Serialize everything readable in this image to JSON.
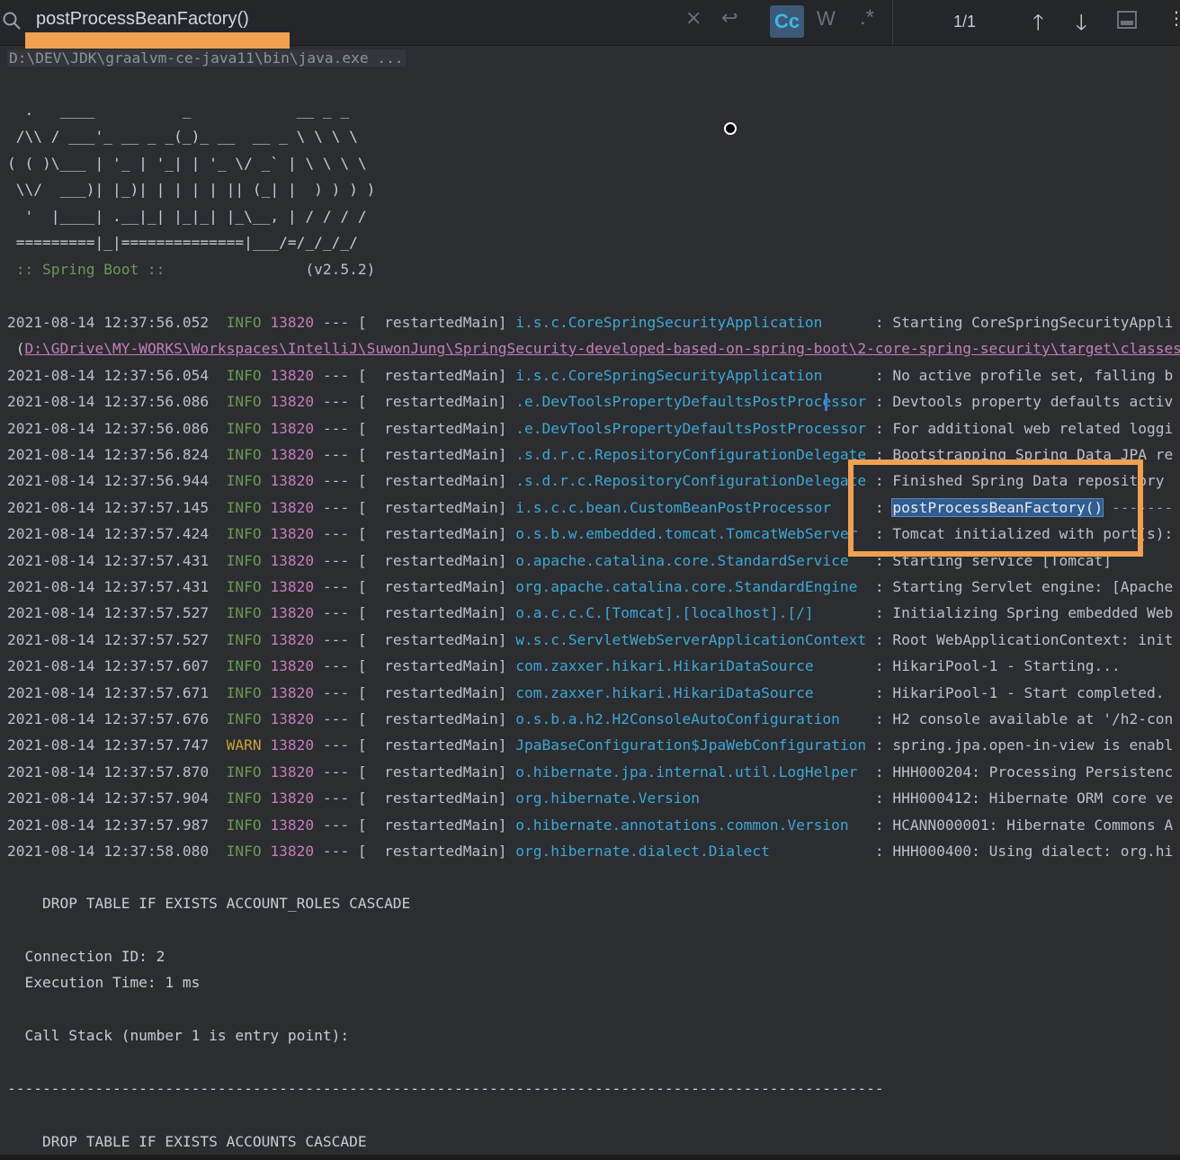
{
  "search": {
    "query": "postProcessBeanFactory()",
    "clear_glyph": "×",
    "newline_glyph": "↩",
    "match_case_label": "Cc",
    "words_label": "W",
    "regex_label": ".*",
    "match_count": "1/1",
    "prev_glyph": "🡑",
    "next_glyph": "🡓",
    "more_glyph": "⋮"
  },
  "console": {
    "command": "D:\\DEV\\JDK\\graalvm-ce-java11\\bin\\java.exe ...",
    "banner": [
      "  .   ____          _            __ _ _",
      " /\\\\ / ___'_ __ _ _(_)_ __  __ _ \\ \\ \\ \\",
      "( ( )\\___ | '_ | '_| | '_ \\/ _` | \\ \\ \\ \\",
      " \\\\/  ___)| |_)| | | | | || (_| |  ) ) ) )",
      "  '  |____| .__|_| |_|_| |_\\__, | / / / /",
      " =========|_|==============|___/=/_/_/_/"
    ],
    "spring_boot_label": " :: Spring Boot ::",
    "spring_boot_version": "(v2.5.2)",
    "logs": [
      {
        "ts": "2021-08-14 12:37:56.052",
        "level": "INFO",
        "pid": "13820",
        "thread": "--- [  restartedMain]",
        "logger": "i.s.c.CoreSpringSecurityApplication     ",
        "msg": "Starting CoreSpringSecurityAppli"
      },
      {
        "ts": "2021-08-14 12:37:56.054",
        "level": "INFO",
        "pid": "13820",
        "thread": "--- [  restartedMain]",
        "logger": "i.s.c.CoreSpringSecurityApplication     ",
        "msg": "No active profile set, falling b"
      },
      {
        "ts": "2021-08-14 12:37:56.086",
        "level": "INFO",
        "pid": "13820",
        "thread": "--- [  restartedMain]",
        "logger": ".e.DevToolsPropertyDefaultsPostProcessor",
        "msg": "Devtools property defaults activ"
      },
      {
        "ts": "2021-08-14 12:37:56.086",
        "level": "INFO",
        "pid": "13820",
        "thread": "--- [  restartedMain]",
        "logger": ".e.DevToolsPropertyDefaultsPostProcessor",
        "msg": "For additional web related loggi"
      },
      {
        "ts": "2021-08-14 12:37:56.824",
        "level": "INFO",
        "pid": "13820",
        "thread": "--- [  restartedMain]",
        "logger": ".s.d.r.c.RepositoryConfigurationDelegate",
        "msg": "Bootstrapping Spring Data JPA re"
      },
      {
        "ts": "2021-08-14 12:37:56.944",
        "level": "INFO",
        "pid": "13820",
        "thread": "--- [  restartedMain]",
        "logger": ".s.d.r.c.RepositoryConfigurationDelegate",
        "msg": "Finished Spring Data repository "
      },
      {
        "ts": "2021-08-14 12:37:57.145",
        "level": "INFO",
        "pid": "13820",
        "thread": "--- [  restartedMain]",
        "logger": "i.s.c.c.bean.CustomBeanPostProcessor    ",
        "msg": "postProcessBeanFactory()",
        "suffix": " -------"
      },
      {
        "ts": "2021-08-14 12:37:57.424",
        "level": "INFO",
        "pid": "13820",
        "thread": "--- [  restartedMain]",
        "logger": "o.s.b.w.embedded.tomcat.TomcatWebServer ",
        "msg": "Tomcat initialized with port(s):"
      },
      {
        "ts": "2021-08-14 12:37:57.431",
        "level": "INFO",
        "pid": "13820",
        "thread": "--- [  restartedMain]",
        "logger": "o.apache.catalina.core.StandardService  ",
        "msg": "Starting service [Tomcat]"
      },
      {
        "ts": "2021-08-14 12:37:57.431",
        "level": "INFO",
        "pid": "13820",
        "thread": "--- [  restartedMain]",
        "logger": "org.apache.catalina.core.StandardEngine ",
        "msg": "Starting Servlet engine: [Apache"
      },
      {
        "ts": "2021-08-14 12:37:57.527",
        "level": "INFO",
        "pid": "13820",
        "thread": "--- [  restartedMain]",
        "logger": "o.a.c.c.C.[Tomcat].[localhost].[/]      ",
        "msg": "Initializing Spring embedded Web"
      },
      {
        "ts": "2021-08-14 12:37:57.527",
        "level": "INFO",
        "pid": "13820",
        "thread": "--- [  restartedMain]",
        "logger": "w.s.c.ServletWebServerApplicationContext",
        "msg": "Root WebApplicationContext: init"
      },
      {
        "ts": "2021-08-14 12:37:57.607",
        "level": "INFO",
        "pid": "13820",
        "thread": "--- [  restartedMain]",
        "logger": "com.zaxxer.hikari.HikariDataSource      ",
        "msg": "HikariPool-1 - Starting..."
      },
      {
        "ts": "2021-08-14 12:37:57.671",
        "level": "INFO",
        "pid": "13820",
        "thread": "--- [  restartedMain]",
        "logger": "com.zaxxer.hikari.HikariDataSource      ",
        "msg": "HikariPool-1 - Start completed."
      },
      {
        "ts": "2021-08-14 12:37:57.676",
        "level": "INFO",
        "pid": "13820",
        "thread": "--- [  restartedMain]",
        "logger": "o.s.b.a.h2.H2ConsoleAutoConfiguration   ",
        "msg": "H2 console available at '/h2-con"
      },
      {
        "ts": "2021-08-14 12:37:57.747",
        "level": "WARN",
        "pid": "13820",
        "thread": "--- [  restartedMain]",
        "logger": "JpaBaseConfiguration$JpaWebConfiguration",
        "msg": "spring.jpa.open-in-view is enabl"
      },
      {
        "ts": "2021-08-14 12:37:57.870",
        "level": "INFO",
        "pid": "13820",
        "thread": "--- [  restartedMain]",
        "logger": "o.hibernate.jpa.internal.util.LogHelper ",
        "msg": "HHH000204: Processing Persistenc"
      },
      {
        "ts": "2021-08-14 12:37:57.904",
        "level": "INFO",
        "pid": "13820",
        "thread": "--- [  restartedMain]",
        "logger": "org.hibernate.Version                   ",
        "msg": "HHH000412: Hibernate ORM core ve"
      },
      {
        "ts": "2021-08-14 12:37:57.987",
        "level": "INFO",
        "pid": "13820",
        "thread": "--- [  restartedMain]",
        "logger": "o.hibernate.annotations.common.Version  ",
        "msg": "HCANN000001: Hibernate Commons A"
      },
      {
        "ts": "2021-08-14 12:37:58.080",
        "level": "INFO",
        "pid": "13820",
        "thread": "--- [  restartedMain]",
        "logger": "org.hibernate.dialect.Dialect           ",
        "msg": "HHH000400: Using dialect: org.hi"
      }
    ],
    "classpath": "D:\\GDrive\\MY-WORKS\\Workspaces\\IntelliJ\\SuwonJung\\SpringSecurity-developed-based-on-spring-boot\\2-core-spring-security\\target\\classes",
    "sql1": "    DROP TABLE IF EXISTS ACCOUNT_ROLES CASCADE",
    "connection_id": "  Connection ID: 2",
    "execution_time": "  Execution Time: 1 ms",
    "call_stack": "  Call Stack (number 1 is entry point):",
    "divider": "----------------------------------------------------------------------------------------------------",
    "sql2": "    DROP TABLE IF EXISTS ACCOUNTS CASCADE"
  },
  "colors": {
    "background": "#2b2d30",
    "info": "#6a9955",
    "warn": "#c9a23c",
    "pid": "#c77dbb",
    "logger": "#3fa7d6",
    "annotation": "#f0a050",
    "search_hit": "#2f5c91"
  }
}
